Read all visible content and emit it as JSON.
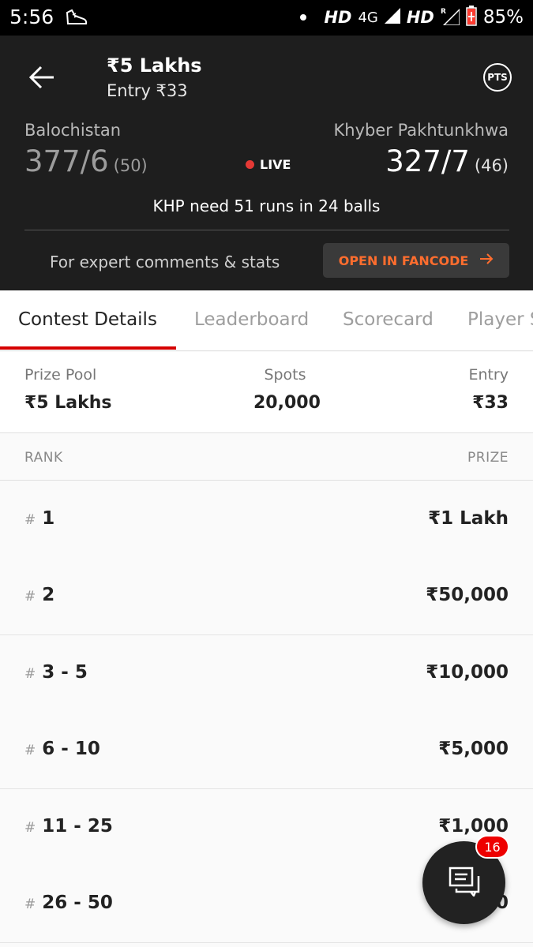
{
  "status": {
    "time": "5:56",
    "hd1": "HD",
    "net": "4G",
    "hd2": "HD",
    "battery": "85%"
  },
  "header": {
    "title": "₹5 Lakhs",
    "subtitle": "Entry ₹33",
    "pts": "PTS",
    "team_left": "Balochistan",
    "score_left": "377/6",
    "overs_left": "(50)",
    "team_right": "Khyber Pakhtunkhwa",
    "score_right": "327/7",
    "overs_right": "(46)",
    "live": "LIVE",
    "need": "KHP need 51 runs in 24 balls",
    "expert": "For expert comments & stats",
    "fancode": "OPEN IN FANCODE"
  },
  "tabs": [
    "Contest Details",
    "Leaderboard",
    "Scorecard",
    "Player Stats"
  ],
  "summary": {
    "prize_pool_label": "Prize Pool",
    "prize_pool": "₹5 Lakhs",
    "spots_label": "Spots",
    "spots": "20,000",
    "entry_label": "Entry",
    "entry": "₹33"
  },
  "rank_header": {
    "rank": "RANK",
    "prize": "PRIZE"
  },
  "rows": [
    {
      "hash": "#",
      "rank": "1",
      "prize": "₹1 Lakh"
    },
    {
      "hash": "#",
      "rank": "2",
      "prize": "₹50,000"
    },
    {
      "hash": "#",
      "rank": "3 - 5",
      "prize": "₹10,000"
    },
    {
      "hash": "#",
      "rank": "6 - 10",
      "prize": "₹5,000"
    },
    {
      "hash": "#",
      "rank": "11 - 25",
      "prize": "₹1,000"
    },
    {
      "hash": "#",
      "rank": "26 - 50",
      "prize": "₹500"
    }
  ],
  "chat_badge": "16",
  "colors": {
    "accent": "#d50000",
    "fancode": "#ff6d2e",
    "header_bg": "#1e1e1e"
  }
}
